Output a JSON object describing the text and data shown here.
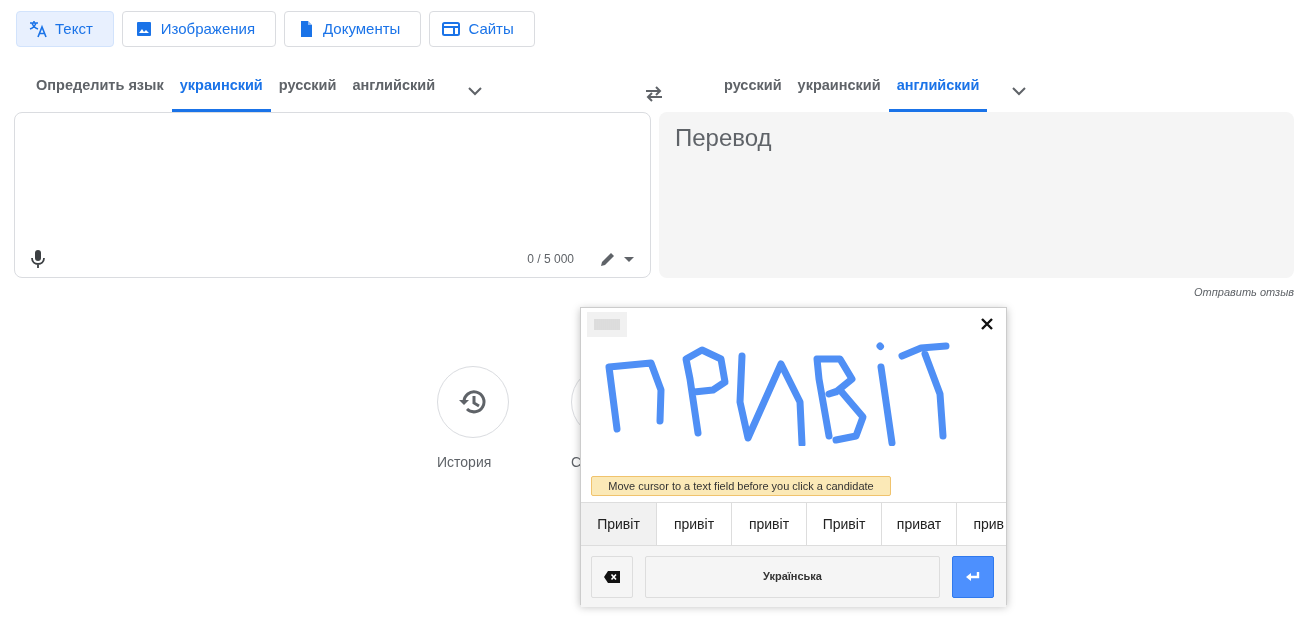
{
  "modes": [
    {
      "label": "Текст",
      "kind": "translate",
      "selected": true
    },
    {
      "label": "Изображения",
      "kind": "image",
      "selected": false
    },
    {
      "label": "Документы",
      "kind": "document",
      "selected": false
    },
    {
      "label": "Сайты",
      "kind": "website",
      "selected": false
    }
  ],
  "source_languages": [
    {
      "label": "Определить язык",
      "selected": false
    },
    {
      "label": "украинский",
      "selected": true
    },
    {
      "label": "русский",
      "selected": false
    },
    {
      "label": "английский",
      "selected": false
    }
  ],
  "target_languages": [
    {
      "label": "русский",
      "selected": false
    },
    {
      "label": "украинский",
      "selected": false
    },
    {
      "label": "английский",
      "selected": true
    }
  ],
  "source": {
    "counter": "0 / 5 000"
  },
  "target": {
    "placeholder": "Перевод"
  },
  "feedback": "Отправить отзыв",
  "shortcuts": [
    {
      "label": "История",
      "kind": "history"
    },
    {
      "label": "С",
      "kind": "saved"
    }
  ],
  "handwriting": {
    "hint": "Move cursor to a text field before you click a candidate",
    "candidates": [
      {
        "label": "Привіт",
        "selected": true
      },
      {
        "label": "привіт",
        "selected": false
      },
      {
        "label": "привіт",
        "selected": false
      },
      {
        "label": "Привіт",
        "selected": false
      },
      {
        "label": "приват",
        "selected": false
      },
      {
        "label": "прив",
        "selected": false
      }
    ],
    "language": "Українська"
  }
}
